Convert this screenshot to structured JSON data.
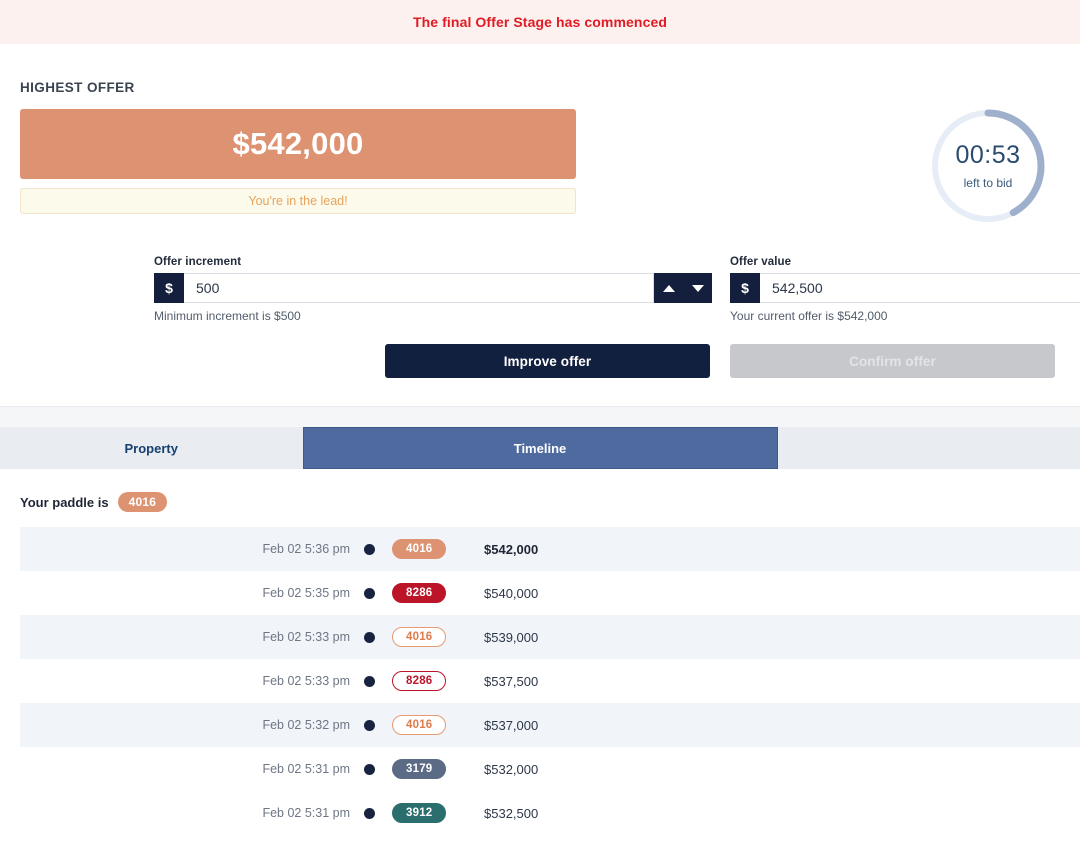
{
  "banner": {
    "message": "The final Offer Stage has commenced",
    "text_color": "#e01b24",
    "background": "#fdf1ef"
  },
  "highest_offer": {
    "label": "HIGHEST OFFER",
    "amount": "$542,000",
    "accent_color": "#dd9372",
    "lead_message": "You're in the lead!"
  },
  "timer": {
    "value": "00:53",
    "caption": "left to bid",
    "track_color": "#e7edf6",
    "progress_color": "#9fb0cd",
    "progress_fraction": 0.42
  },
  "form": {
    "increment": {
      "label": "Offer increment",
      "prefix": "$",
      "value": "500",
      "placeholder": "0",
      "hint": "Minimum increment is $500",
      "stepper_up": "increment-up",
      "stepper_down": "increment-down"
    },
    "offer_value": {
      "label": "Offer value",
      "prefix": "$",
      "value": "542,500",
      "placeholder": "0",
      "hint": "Your current offer is $542,000"
    },
    "improve_label": "Improve offer",
    "confirm_label": "Confirm offer"
  },
  "tabs": [
    {
      "label": "Property",
      "active": false
    },
    {
      "label": "Timeline",
      "active": true
    }
  ],
  "paddle": {
    "label": "Your paddle is",
    "number": "4016"
  },
  "timeline": [
    {
      "time": "Feb 02 5:36 pm",
      "paddle": "4016",
      "amount": "$542,000",
      "style": "badge-filled-salmon",
      "bold": true,
      "striped": true
    },
    {
      "time": "Feb 02 5:35 pm",
      "paddle": "8286",
      "amount": "$540,000",
      "style": "badge-filled-crimson",
      "bold": false,
      "striped": false
    },
    {
      "time": "Feb 02 5:33 pm",
      "paddle": "4016",
      "amount": "$539,000",
      "style": "badge-outline-salmon",
      "bold": false,
      "striped": true
    },
    {
      "time": "Feb 02 5:33 pm",
      "paddle": "8286",
      "amount": "$537,500",
      "style": "badge-outline-crimson",
      "bold": false,
      "striped": false
    },
    {
      "time": "Feb 02 5:32 pm",
      "paddle": "4016",
      "amount": "$537,000",
      "style": "badge-outline-salmon",
      "bold": false,
      "striped": true
    },
    {
      "time": "Feb 02 5:31 pm",
      "paddle": "3179",
      "amount": "$532,000",
      "style": "badge-filled-slate",
      "bold": false,
      "striped": false
    },
    {
      "time": "Feb 02 5:31 pm",
      "paddle": "3912",
      "amount": "$532,500",
      "style": "badge-filled-teal",
      "bold": false,
      "striped": false
    }
  ]
}
